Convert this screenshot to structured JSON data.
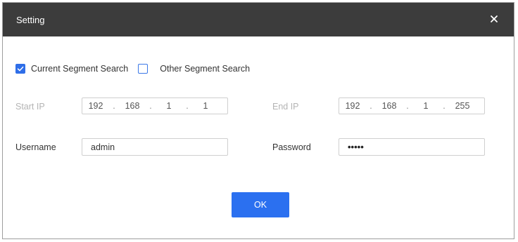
{
  "window": {
    "title": "Setting"
  },
  "search_mode": {
    "current": {
      "label": "Current Segment Search",
      "checked": true
    },
    "other": {
      "label": "Other Segment Search",
      "checked": false
    }
  },
  "start_ip": {
    "label": "Start IP",
    "octets": [
      "192",
      "168",
      "1",
      "1"
    ]
  },
  "end_ip": {
    "label": "End IP",
    "octets": [
      "192",
      "168",
      "1",
      "255"
    ]
  },
  "ip_separator": ".",
  "username": {
    "label": "Username",
    "value": "admin"
  },
  "password": {
    "label": "Password",
    "masked_value": "•••••"
  },
  "ok_button": {
    "label": "OK"
  },
  "colors": {
    "titlebar": "#3c3c3c",
    "accent": "#2b70f0",
    "disabled_text": "#b4b4b4"
  },
  "icons": {
    "close": "close-icon",
    "check": "checkmark-icon"
  }
}
